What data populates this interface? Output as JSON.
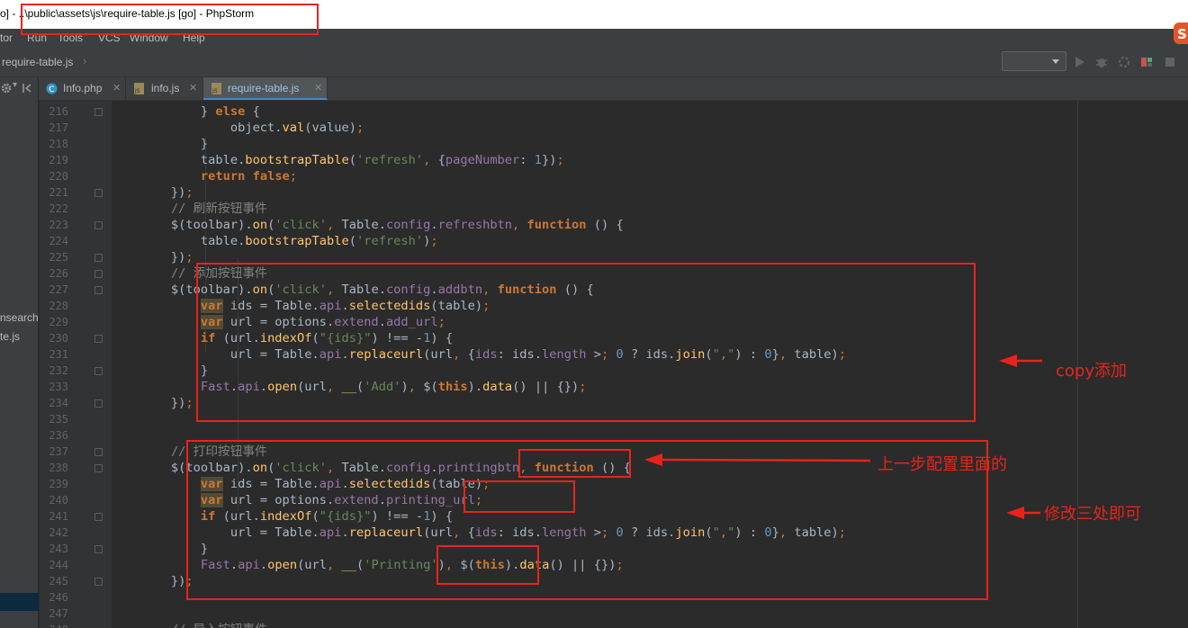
{
  "window": {
    "title": "o] - ..\\public\\assets\\js\\require-table.js [go] - PhpStorm"
  },
  "menu": [
    "tor",
    "Run",
    "Tools",
    "VCS",
    "Window",
    "Help"
  ],
  "navbar": {
    "breadcrumb": "require-table.js",
    "run_config": ""
  },
  "project_panel": {
    "items": [
      "nsearch",
      "te.js"
    ]
  },
  "tabs": [
    {
      "label": "Info.php",
      "icon": "php-class-icon",
      "active": false
    },
    {
      "label": "info.js",
      "icon": "js-file-icon",
      "active": false
    },
    {
      "label": "require-table.js",
      "icon": "js-file-icon",
      "active": true
    }
  ],
  "editor": {
    "first_line": 216,
    "lines": [
      "            } else {",
      "                object.val(value);",
      "            }",
      "            table.bootstrapTable('refresh', {pageNumber: 1});",
      "            return false;",
      "        });",
      "        // 刷新按钮事件",
      "        $(toolbar).on('click', Table.config.refreshbtn, function () {",
      "            table.bootstrapTable('refresh');",
      "        });",
      "        // 添加按钮事件",
      "        $(toolbar).on('click', Table.config.addbtn, function () {",
      "            var ids = Table.api.selectedids(table);",
      "            var url = options.extend.add_url;",
      "            if (url.indexOf(\"{ids}\") !== -1) {",
      "                url = Table.api.replaceurl(url, {ids: ids.length > 0 ? ids.join(\",\") : 0}, table);",
      "            }",
      "            Fast.api.open(url, __('Add'), $(this).data() || {});",
      "        });",
      "",
      "",
      "        // 打印按钮事件",
      "        $(toolbar).on('click', Table.config.printingbtn, function () {",
      "            var ids = Table.api.selectedids(table);",
      "            var url = options.extend.printing_url;",
      "            if (url.indexOf(\"{ids}\") !== -1) {",
      "                url = Table.api.replaceurl(url, {ids: ids.length > 0 ? ids.join(\",\") : 0}, table);",
      "            }",
      "            Fast.api.open(url, __('Printing'), $(this).data() || {});",
      "        });",
      "",
      "",
      "        // 导入按钮事件"
    ]
  },
  "annotations": {
    "copy_add": "copy添加",
    "previous_step": "上一步配置里面的",
    "modify_three": "修改三处即可"
  },
  "colors": {
    "annotation_red": "#e8231b",
    "editor_bg": "#2b2b2b",
    "keyword": "#cc7832",
    "string": "#6a8759",
    "function": "#ffc66d",
    "property": "#9876aa",
    "comment": "#808080",
    "number": "#6897bb"
  }
}
